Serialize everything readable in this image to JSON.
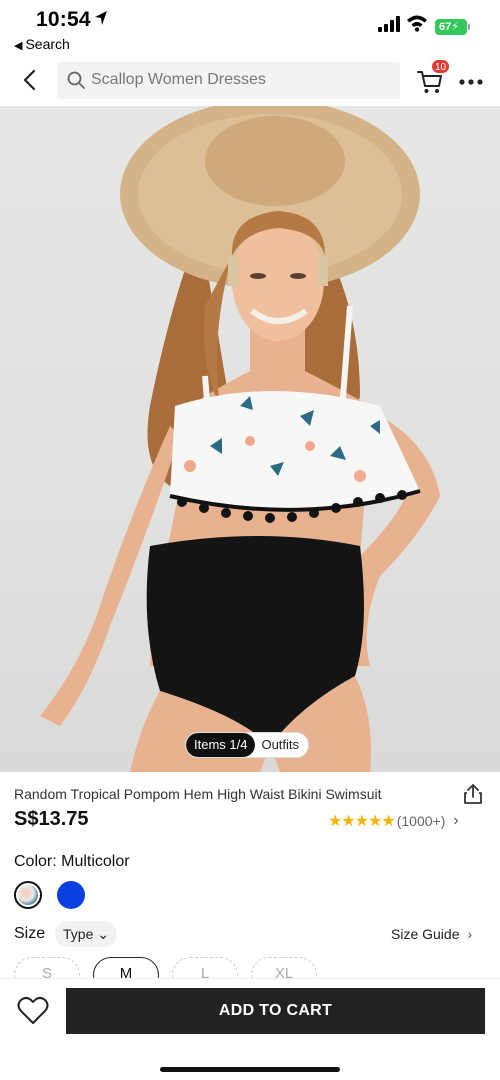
{
  "status": {
    "time": "10:54",
    "back_app": "Search",
    "battery": "67"
  },
  "topbar": {
    "search_placeholder": "Scallop Women Dresses",
    "cart_count": "10"
  },
  "hero": {
    "items_label": "Items 1/4",
    "outfits_label": "Outfits"
  },
  "product": {
    "title": "Random Tropical Pompom Hem High Waist Bikini Swimsuit",
    "price": "S$13.75",
    "rating_count": "(1000+)",
    "rating_stars": 4.5,
    "color_label": "Color: Multicolor",
    "colors": [
      {
        "name": "multicolor",
        "hex": "#2b6b86"
      },
      {
        "name": "blue",
        "hex": "#0a3fe0"
      }
    ],
    "size_label": "Size",
    "type_chip": "Type",
    "size_guide": "Size Guide",
    "sizes": [
      "S",
      "M",
      "L",
      "XL"
    ],
    "selected_size": "M"
  },
  "bottom": {
    "add_to_cart": "ADD TO CART"
  }
}
